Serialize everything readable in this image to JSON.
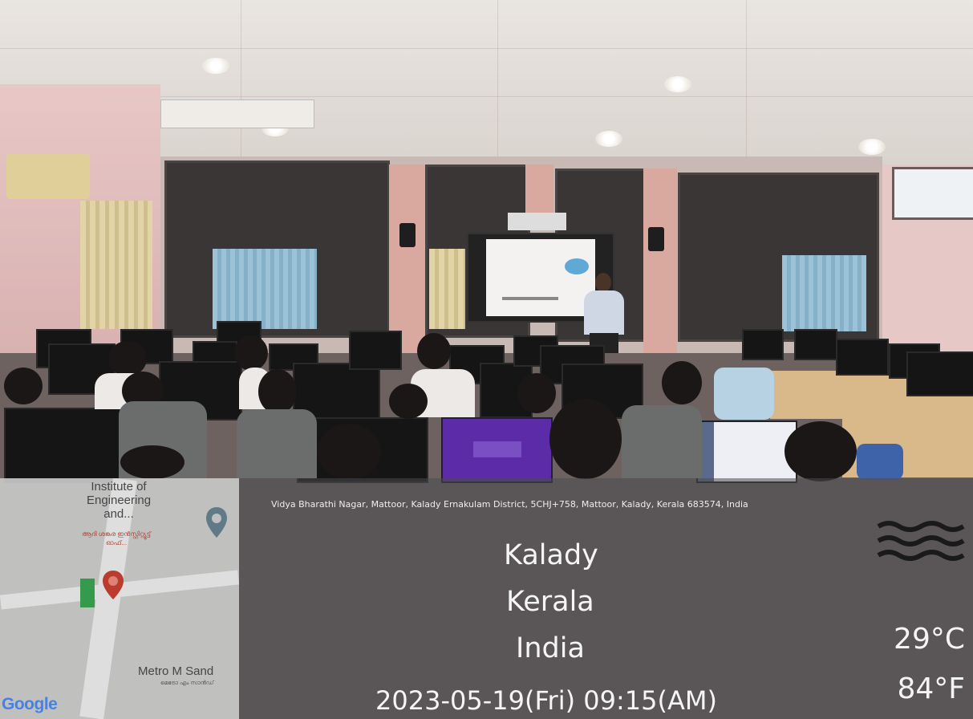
{
  "map": {
    "place_name": "Institute of Engineering and...",
    "place_name_local": "ആദി ശങ്കര ഇൻസ്റ്റിറ്റ്യൂട്ട് ഓഫ്...",
    "nearby_place": "Metro M Sand",
    "nearby_place_local": "മെട്രോ എം സാൻഡ്",
    "attribution": "Google"
  },
  "location": {
    "address": "Vidya Bharathi Nagar, Mattoor, Kalady Ernakulam District, 5CHJ+758, Mattoor, Kalady, Kerala 683574, India",
    "city": "Kalady",
    "state": "Kerala",
    "country": "India"
  },
  "weather": {
    "icon": "haze-icon",
    "temperature": "29°C",
    "temperature_f": "84°F"
  },
  "timestamp": "2023-05-19(Fri)   09:15(AM)",
  "colors": {
    "overlay": "#4b4b50",
    "text": "#f5f5f5",
    "pin_red": "#c0392b",
    "pin_blue": "#607d8b"
  }
}
